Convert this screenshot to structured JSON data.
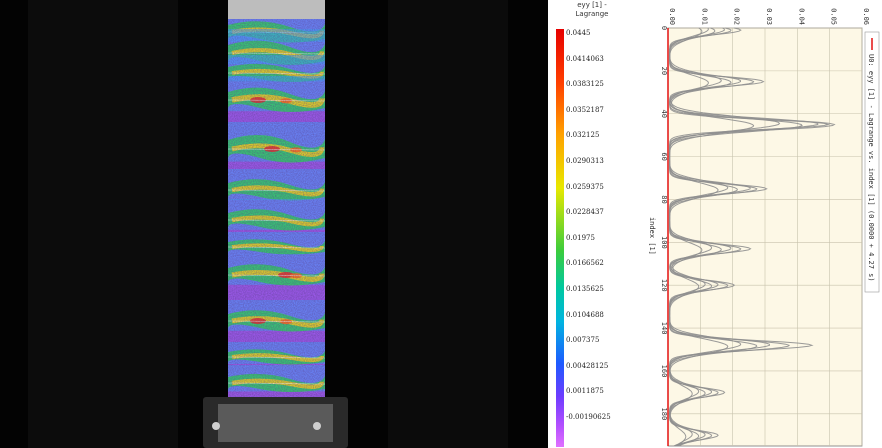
{
  "legend": {
    "title_line1": "eyy [1] -",
    "title_line2": "Lagrange",
    "ticks": [
      "0.0445",
      "0.0414063",
      "0.0383125",
      "0.0352187",
      "0.032125",
      "0.0290313",
      "0.0259375",
      "0.0228437",
      "0.01975",
      "0.0166562",
      "0.0135625",
      "0.0104688",
      "0.007375",
      "0.00428125",
      "0.0011875",
      "-0.00190625"
    ]
  },
  "colors": {
    "camera_background": "#030303",
    "specimen_purple": "#9a58e8",
    "plot_background": "#fdf8e6",
    "series_line": "#8f8f8f",
    "reference_line": "#e00000"
  },
  "chart_data": {
    "type": "line",
    "orientation": "rotated",
    "xlabel": "index [1]",
    "x_tick_labels": [
      "0",
      "20",
      "40",
      "60",
      "80",
      "100",
      "120",
      "140",
      "160",
      "180"
    ],
    "y_tick_labels": [
      "0.00",
      "0.01",
      "0.02",
      "0.03",
      "0.04",
      "0.05",
      "0.06"
    ],
    "xlim": [
      0,
      195
    ],
    "ylim": [
      0,
      0.06
    ],
    "grid": true,
    "legend": "right",
    "legend_entries": [
      "U0: eyy [1] - Lagrange vs. index [1] (0.0000 + 4.27 s)"
    ],
    "peaks": [
      {
        "index": 1,
        "values": [
          0.022,
          0.019,
          0.017,
          0.014,
          0.012,
          0.01
        ]
      },
      {
        "index": 25,
        "values": [
          0.029,
          0.026,
          0.022,
          0.019,
          0.016,
          0.012
        ]
      },
      {
        "index": 45,
        "values": [
          0.049,
          0.051,
          0.046,
          0.041,
          0.034,
          0.026
        ]
      },
      {
        "index": 75,
        "values": [
          0.03,
          0.027,
          0.025,
          0.021,
          0.018,
          0.015
        ]
      },
      {
        "index": 103,
        "values": [
          0.025,
          0.022,
          0.019,
          0.016,
          0.013,
          0.01
        ]
      },
      {
        "index": 120,
        "values": [
          0.02,
          0.018,
          0.015,
          0.013,
          0.011,
          0.009
        ]
      },
      {
        "index": 148,
        "values": [
          0.044,
          0.037,
          0.031,
          0.027,
          0.022,
          0.018
        ]
      },
      {
        "index": 170,
        "values": [
          0.017,
          0.015,
          0.013,
          0.011,
          0.009,
          0.007
        ]
      },
      {
        "index": 190,
        "values": [
          0.015,
          0.013,
          0.011,
          0.009,
          0.007,
          0.005
        ]
      }
    ],
    "reference_value": 0.0
  }
}
